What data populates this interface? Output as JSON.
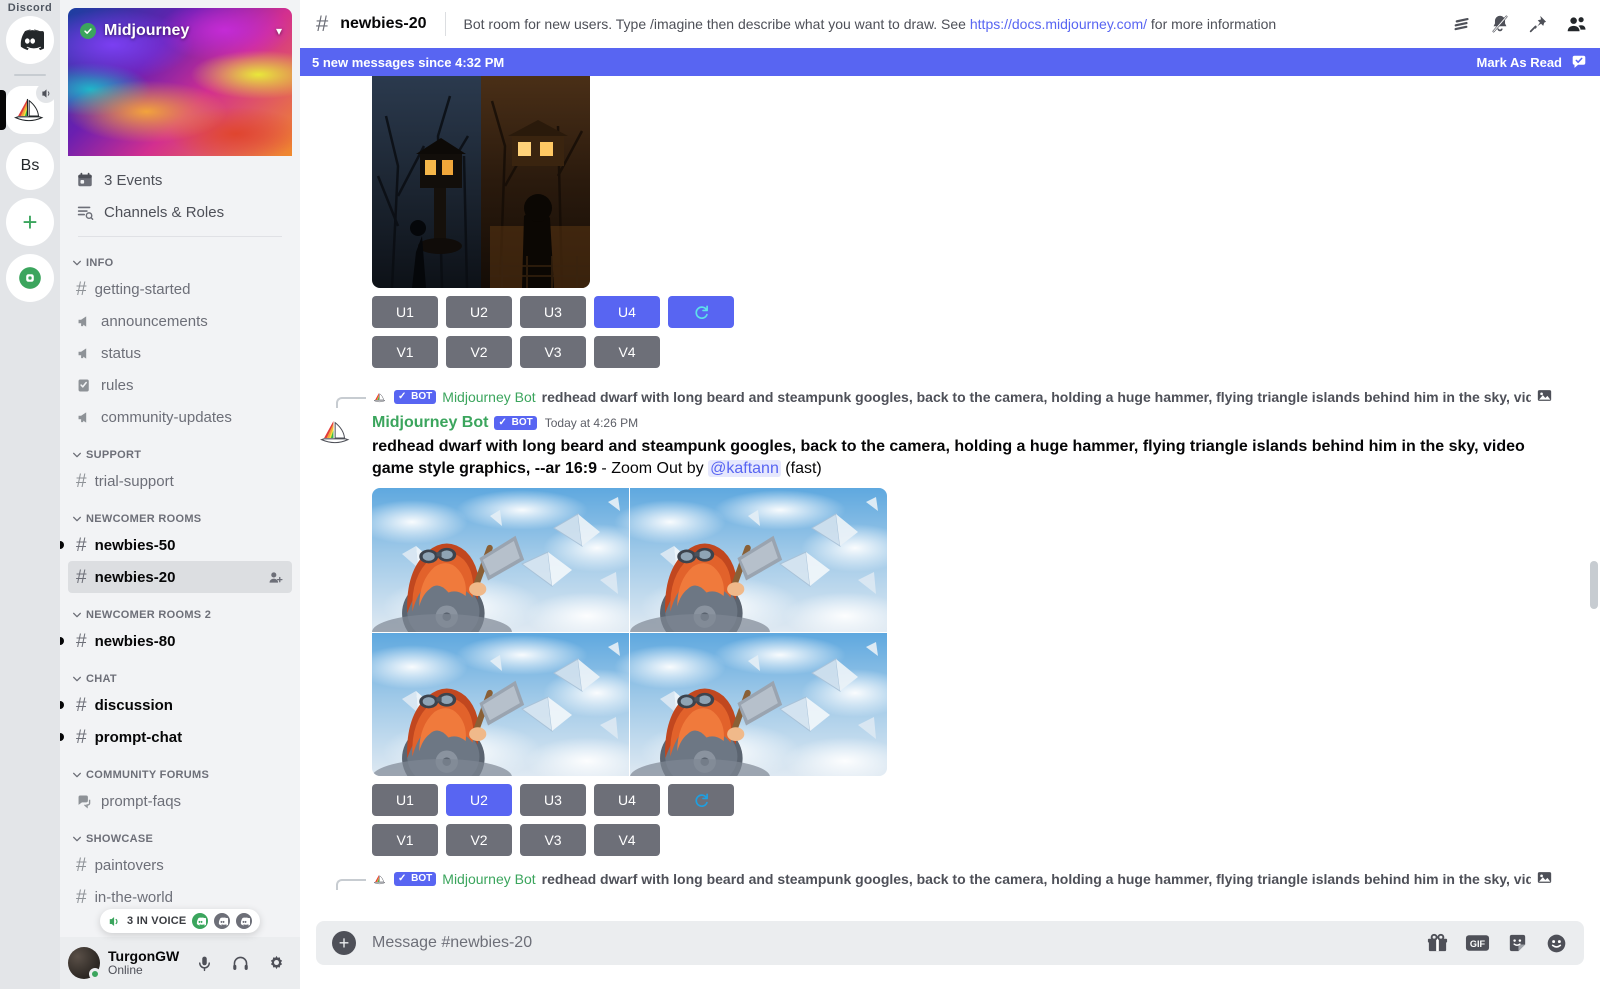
{
  "rail": {
    "wordmark": "Discord",
    "servers": [
      {
        "name": "discord-home",
        "label": "",
        "icon": "discord-logo"
      },
      {
        "name": "midjourney",
        "label": "",
        "icon": "sailboat",
        "selected": true,
        "badge": "speaker"
      },
      {
        "name": "bs-server",
        "label": "Bs",
        "icon": "text"
      },
      {
        "name": "add-server",
        "label": "+",
        "icon": "plus"
      },
      {
        "name": "explore",
        "label": "",
        "icon": "compass"
      }
    ]
  },
  "sidebar": {
    "server_name": "Midjourney",
    "quick_items": [
      {
        "label": "3 Events",
        "icon": "calendar-icon",
        "name": "events"
      },
      {
        "label": "Channels & Roles",
        "icon": "channels-roles-icon",
        "name": "channels-roles"
      }
    ],
    "categories": [
      {
        "label": "INFO",
        "channels": [
          {
            "label": "getting-started",
            "type": "text",
            "state": "default"
          },
          {
            "label": "announcements",
            "type": "announcement",
            "state": "default"
          },
          {
            "label": "status",
            "type": "announcement",
            "state": "default"
          },
          {
            "label": "rules",
            "type": "rules",
            "state": "default"
          },
          {
            "label": "community-updates",
            "type": "announcement",
            "state": "default"
          }
        ]
      },
      {
        "label": "SUPPORT",
        "channels": [
          {
            "label": "trial-support",
            "type": "text",
            "state": "default"
          }
        ]
      },
      {
        "label": "NEWCOMER ROOMS",
        "channels": [
          {
            "label": "newbies-50",
            "type": "text-locked",
            "state": "unread"
          },
          {
            "label": "newbies-20",
            "type": "text-locked",
            "state": "active"
          }
        ]
      },
      {
        "label": "NEWCOMER ROOMS 2",
        "channels": [
          {
            "label": "newbies-80",
            "type": "text-locked",
            "state": "unread"
          }
        ]
      },
      {
        "label": "CHAT",
        "channels": [
          {
            "label": "discussion",
            "type": "text",
            "state": "unread"
          },
          {
            "label": "prompt-chat",
            "type": "text",
            "state": "unread"
          }
        ]
      },
      {
        "label": "COMMUNITY FORUMS",
        "channels": [
          {
            "label": "prompt-faqs",
            "type": "forum",
            "state": "default"
          }
        ]
      },
      {
        "label": "SHOWCASE",
        "channels": [
          {
            "label": "paintovers",
            "type": "text",
            "state": "default"
          },
          {
            "label": "in-the-world",
            "type": "text",
            "state": "default"
          }
        ]
      }
    ],
    "voice_badge": {
      "label": "3 IN VOICE",
      "avatar_count": 3
    },
    "user": {
      "name": "TurgonGW",
      "status": "Online"
    }
  },
  "topbar": {
    "channel": "newbies-20",
    "topic_before": "Bot room for new users. Type /imagine then describe what you want to draw. See ",
    "topic_link": "https://docs.midjourney.com/",
    "topic_after": " for more information",
    "icons": [
      "threads-icon",
      "notification-off-icon",
      "pin-icon",
      "members-icon"
    ]
  },
  "new_banner": {
    "text": "5 new messages since 4:32 PM",
    "mark_label": "Mark As Read"
  },
  "messages": {
    "top_buttons": {
      "row1": [
        {
          "label": "U1",
          "active": false
        },
        {
          "label": "U2",
          "active": false
        },
        {
          "label": "U3",
          "active": false
        },
        {
          "label": "U4",
          "active": true
        },
        {
          "label": "refresh-icon",
          "active": true,
          "icon": true
        }
      ],
      "row2": [
        {
          "label": "V1",
          "active": false
        },
        {
          "label": "V2",
          "active": false
        },
        {
          "label": "V3",
          "active": false
        },
        {
          "label": "V4",
          "active": false
        }
      ]
    },
    "reply_preview_1": {
      "author": "Midjourney Bot",
      "bot_tag": "BOT",
      "text": "redhead dwarf with long beard and steampunk googles, back to the camera, holding a huge hammer, flying triangle islands behind him in the sky, video game style graphics"
    },
    "message_1": {
      "author": "Midjourney Bot",
      "bot_tag": "BOT",
      "timestamp": "Today at 4:26 PM",
      "prompt": "redhead dwarf with long beard and steampunk googles, back to the camera, holding a huge hammer, flying triangle islands behind him in the sky, video game style graphics, --ar 16:9",
      "action_separator": " - ",
      "action": "Zoom Out by ",
      "mention": "@kaftann",
      "speed": " (fast)"
    },
    "mid_buttons": {
      "row1": [
        {
          "label": "U1",
          "active": false
        },
        {
          "label": "U2",
          "active": true
        },
        {
          "label": "U3",
          "active": false
        },
        {
          "label": "U4",
          "active": false
        },
        {
          "label": "refresh-icon",
          "active": false,
          "icon": true
        }
      ],
      "row2": [
        {
          "label": "V1",
          "active": false
        },
        {
          "label": "V2",
          "active": false
        },
        {
          "label": "V3",
          "active": false
        },
        {
          "label": "V4",
          "active": false
        }
      ]
    },
    "reply_preview_2": {
      "author": "Midjourney Bot",
      "bot_tag": "BOT",
      "text": "redhead dwarf with long beard and steampunk googles, back to the camera, holding a huge hammer, flying triangle islands behind him in the sky, video game style graphics"
    }
  },
  "composer": {
    "placeholder": "Message #newbies-20",
    "value": "",
    "icons": [
      "gift-icon",
      "gif-icon",
      "sticker-icon",
      "emoji-icon"
    ]
  },
  "colors": {
    "accent": "#5865f2",
    "bot_green": "#3ba55d",
    "button_grey": "#6d6f78",
    "sidebar_bg": "#f2f3f5",
    "rail_bg": "#e3e5e8"
  }
}
